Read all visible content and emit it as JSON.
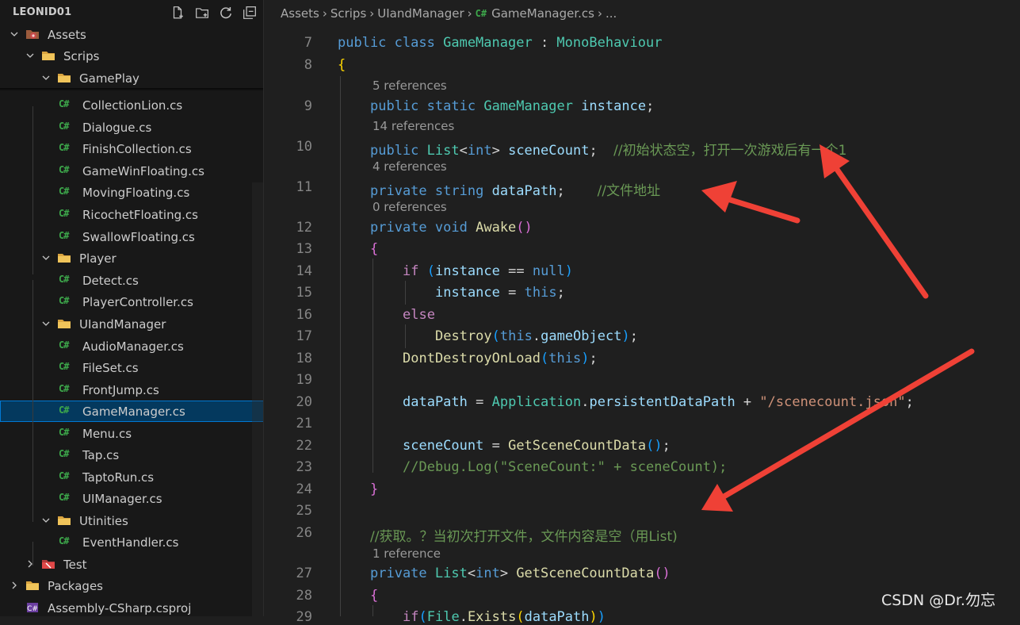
{
  "explorer": {
    "title": "LEONID01",
    "actions": [
      "new-file",
      "new-folder",
      "refresh",
      "collapse-all"
    ],
    "items": [
      {
        "label": "Assets",
        "depth": 0,
        "kind": "folder-special",
        "expanded": true
      },
      {
        "label": "Scrips",
        "depth": 1,
        "kind": "folder",
        "expanded": true
      },
      {
        "label": "GamePlay",
        "depth": 2,
        "kind": "folder",
        "expanded": true
      },
      {
        "label": "CollectionLion.cs",
        "depth": 3,
        "kind": "cs"
      },
      {
        "label": "Dialogue.cs",
        "depth": 3,
        "kind": "cs"
      },
      {
        "label": "FinishCollection.cs",
        "depth": 3,
        "kind": "cs"
      },
      {
        "label": "GameWinFloating.cs",
        "depth": 3,
        "kind": "cs"
      },
      {
        "label": "MovingFloating.cs",
        "depth": 3,
        "kind": "cs"
      },
      {
        "label": "RicochetFloating.cs",
        "depth": 3,
        "kind": "cs"
      },
      {
        "label": "SwallowFloating.cs",
        "depth": 3,
        "kind": "cs"
      },
      {
        "label": "Player",
        "depth": 2,
        "kind": "folder",
        "expanded": true
      },
      {
        "label": "Detect.cs",
        "depth": 3,
        "kind": "cs"
      },
      {
        "label": "PlayerController.cs",
        "depth": 3,
        "kind": "cs"
      },
      {
        "label": "UIandManager",
        "depth": 2,
        "kind": "folder",
        "expanded": true
      },
      {
        "label": "AudioManager.cs",
        "depth": 3,
        "kind": "cs"
      },
      {
        "label": "FileSet.cs",
        "depth": 3,
        "kind": "cs"
      },
      {
        "label": "FrontJump.cs",
        "depth": 3,
        "kind": "cs"
      },
      {
        "label": "GameManager.cs",
        "depth": 3,
        "kind": "cs",
        "selected": true
      },
      {
        "label": "Menu.cs",
        "depth": 3,
        "kind": "cs"
      },
      {
        "label": "Tap.cs",
        "depth": 3,
        "kind": "cs"
      },
      {
        "label": "TaptoRun.cs",
        "depth": 3,
        "kind": "cs"
      },
      {
        "label": "UIManager.cs",
        "depth": 3,
        "kind": "cs"
      },
      {
        "label": "Utinities",
        "depth": 2,
        "kind": "folder",
        "expanded": true
      },
      {
        "label": "EventHandler.cs",
        "depth": 3,
        "kind": "cs"
      },
      {
        "label": "Test",
        "depth": 1,
        "kind": "folder-red",
        "expanded": false
      },
      {
        "label": "Packages",
        "depth": 0,
        "kind": "folder",
        "expanded": false
      },
      {
        "label": "Assembly-CSharp.csproj",
        "depth": 0,
        "kind": "csproj"
      }
    ],
    "cs_badge": "C#"
  },
  "breadcrumb": {
    "segments": [
      "Assets",
      "Scrips",
      "UIandManager",
      "GameManager.cs",
      "..."
    ],
    "file_badge": "C#"
  },
  "code": {
    "lines": [
      {
        "n": "7",
        "lens": null,
        "indent": 0,
        "tokens": [
          [
            "kw",
            "public"
          ],
          [
            "pl",
            " "
          ],
          [
            "kw",
            "class"
          ],
          [
            "pl",
            " "
          ],
          [
            "ty",
            "GameManager"
          ],
          [
            "pl",
            " : "
          ],
          [
            "ty",
            "MonoBehaviour"
          ]
        ]
      },
      {
        "n": "8",
        "lens": null,
        "indent": 0,
        "tokens": [
          [
            "br1",
            "{"
          ]
        ]
      },
      {
        "n": "9",
        "lens": "5 references",
        "indent": 1,
        "tokens": [
          [
            "kw",
            "public"
          ],
          [
            "pl",
            " "
          ],
          [
            "kw",
            "static"
          ],
          [
            "pl",
            " "
          ],
          [
            "ty",
            "GameManager"
          ],
          [
            "pl",
            " "
          ],
          [
            "vr",
            "instance"
          ],
          [
            "pl",
            ";"
          ]
        ]
      },
      {
        "n": "10",
        "lens": "14 references",
        "indent": 1,
        "tokens": [
          [
            "kw",
            "public"
          ],
          [
            "pl",
            " "
          ],
          [
            "ty",
            "List"
          ],
          [
            "pl",
            "<"
          ],
          [
            "kw",
            "int"
          ],
          [
            "pl",
            "> "
          ],
          [
            "vr",
            "sceneCount"
          ],
          [
            "pl",
            ";  "
          ],
          [
            "cm",
            "//初始状态空，打开一次游戏后有一个1"
          ]
        ]
      },
      {
        "n": "11",
        "lens": "4 references",
        "indent": 1,
        "tokens": [
          [
            "kw",
            "private"
          ],
          [
            "pl",
            " "
          ],
          [
            "kw",
            "string"
          ],
          [
            "pl",
            " "
          ],
          [
            "vr",
            "dataPath"
          ],
          [
            "pl",
            ";    "
          ],
          [
            "cm",
            "//文件地址"
          ]
        ]
      },
      {
        "n": "12",
        "lens": "0 references",
        "indent": 1,
        "tokens": [
          [
            "kw",
            "private"
          ],
          [
            "pl",
            " "
          ],
          [
            "kw",
            "void"
          ],
          [
            "pl",
            " "
          ],
          [
            "fn",
            "Awake"
          ],
          [
            "br2",
            "()"
          ]
        ]
      },
      {
        "n": "13",
        "lens": null,
        "indent": 1,
        "tokens": [
          [
            "br2",
            "{"
          ]
        ]
      },
      {
        "n": "14",
        "lens": null,
        "indent": 2,
        "tokens": [
          [
            "ctl",
            "if"
          ],
          [
            "pl",
            " "
          ],
          [
            "br3",
            "("
          ],
          [
            "vr",
            "instance"
          ],
          [
            "pl",
            " == "
          ],
          [
            "kw",
            "null"
          ],
          [
            "br3",
            ")"
          ]
        ]
      },
      {
        "n": "15",
        "lens": null,
        "indent": 3,
        "tokens": [
          [
            "vr",
            "instance"
          ],
          [
            "pl",
            " = "
          ],
          [
            "kw",
            "this"
          ],
          [
            "pl",
            ";"
          ]
        ]
      },
      {
        "n": "16",
        "lens": null,
        "indent": 2,
        "tokens": [
          [
            "ctl",
            "else"
          ]
        ]
      },
      {
        "n": "17",
        "lens": null,
        "indent": 3,
        "tokens": [
          [
            "fn",
            "Destroy"
          ],
          [
            "br3",
            "("
          ],
          [
            "kw",
            "this"
          ],
          [
            "pl",
            "."
          ],
          [
            "vr",
            "gameObject"
          ],
          [
            "br3",
            ")"
          ],
          [
            "pl",
            ";"
          ]
        ]
      },
      {
        "n": "18",
        "lens": null,
        "indent": 2,
        "tokens": [
          [
            "fn",
            "DontDestroyOnLoad"
          ],
          [
            "br3",
            "("
          ],
          [
            "kw",
            "this"
          ],
          [
            "br3",
            ")"
          ],
          [
            "pl",
            ";"
          ]
        ]
      },
      {
        "n": "19",
        "lens": null,
        "indent": 2,
        "tokens": []
      },
      {
        "n": "20",
        "lens": null,
        "indent": 2,
        "tokens": [
          [
            "vr",
            "dataPath"
          ],
          [
            "pl",
            " = "
          ],
          [
            "ty",
            "Application"
          ],
          [
            "pl",
            "."
          ],
          [
            "vr",
            "persistentDataPath"
          ],
          [
            "pl",
            " + "
          ],
          [
            "st",
            "\"/scenecount.json\""
          ],
          [
            "pl",
            ";"
          ]
        ]
      },
      {
        "n": "21",
        "lens": null,
        "indent": 2,
        "tokens": []
      },
      {
        "n": "22",
        "lens": null,
        "indent": 2,
        "tokens": [
          [
            "vr",
            "sceneCount"
          ],
          [
            "pl",
            " = "
          ],
          [
            "fn",
            "GetSceneCountData"
          ],
          [
            "br3",
            "()"
          ],
          [
            "pl",
            ";"
          ]
        ]
      },
      {
        "n": "23",
        "lens": null,
        "indent": 2,
        "tokens": [
          [
            "cm",
            "//Debug.Log(\"SceneCount:\" + sceneCount);"
          ]
        ]
      },
      {
        "n": "24",
        "lens": null,
        "indent": 1,
        "tokens": [
          [
            "br2",
            "}"
          ]
        ]
      },
      {
        "n": "25",
        "lens": null,
        "indent": 1,
        "tokens": []
      },
      {
        "n": "26",
        "lens": null,
        "indent": 1,
        "tokens": [
          [
            "cm",
            "//获取。？当初次打开文件，文件内容是空（用List)"
          ]
        ]
      },
      {
        "n": "27",
        "lens": "1 reference",
        "indent": 1,
        "tokens": [
          [
            "kw",
            "private"
          ],
          [
            "pl",
            " "
          ],
          [
            "ty",
            "List"
          ],
          [
            "pl",
            "<"
          ],
          [
            "kw",
            "int"
          ],
          [
            "pl",
            "> "
          ],
          [
            "fn",
            "GetSceneCountData"
          ],
          [
            "br2",
            "()"
          ]
        ]
      },
      {
        "n": "28",
        "lens": null,
        "indent": 1,
        "tokens": [
          [
            "br2",
            "{"
          ]
        ]
      },
      {
        "n": "29",
        "lens": null,
        "indent": 2,
        "tokens": [
          [
            "ctl",
            "if"
          ],
          [
            "br3",
            "("
          ],
          [
            "ty",
            "File"
          ],
          [
            "pl",
            "."
          ],
          [
            "fn",
            "Exists"
          ],
          [
            "br1",
            "("
          ],
          [
            "vr",
            "dataPath"
          ],
          [
            "br1",
            ")"
          ],
          [
            "br3",
            ")"
          ]
        ]
      }
    ]
  },
  "watermark": "CSDN @Dr.勿忘",
  "accent": "#0078d4",
  "annotation_color": "#ef4136"
}
